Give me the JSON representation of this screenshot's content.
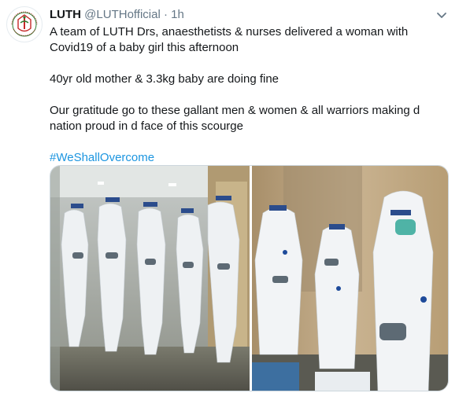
{
  "tweet": {
    "display_name": "LUTH",
    "handle": "@LUTHofficial",
    "separator": "·",
    "time": "1h",
    "text_line1": "A team of LUTH Drs, anaesthetists & nurses delivered a  woman with\nCovid19 of a baby girl this afternoon",
    "text_line2": "40yr old mother & 3.3kg baby are doing fine",
    "text_line3": "Our gratitude go to these gallant men & women & all warriors making d\nnation proud in d face of this scourge",
    "hashtag": "#WeShallOvercome"
  },
  "avatar": {
    "logo_text": "LAGOS UNIVERSITY TEACHING HOSPITAL"
  },
  "media": {
    "photo_left_icon": "photo-medical-team-in-ppe-hallway",
    "photo_right_icon": "photo-medical-team-in-ppe-ward"
  },
  "colors": {
    "hashtag": "#1b95e0",
    "secondary_text": "#657786",
    "primary_text": "#14171a"
  }
}
